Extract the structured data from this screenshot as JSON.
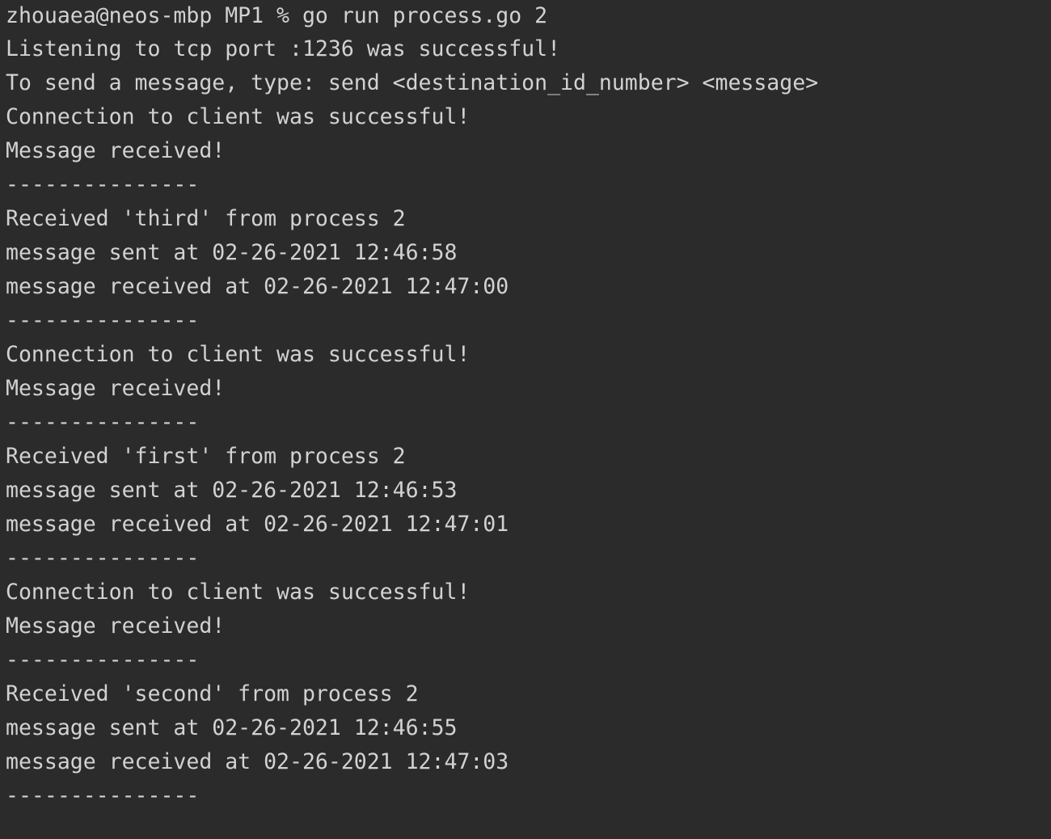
{
  "terminal": {
    "lines": [
      "zhouaea@neos-mbp MP1 % go run process.go 2",
      "Listening to tcp port :1236 was successful!",
      "To send a message, type: send <destination_id_number> <message>",
      "Connection to client was successful!",
      "Message received!",
      "---------------",
      "Received 'third' from process 2",
      "message sent at 02-26-2021 12:46:58",
      "message received at 02-26-2021 12:47:00",
      "---------------",
      "Connection to client was successful!",
      "Message received!",
      "---------------",
      "Received 'first' from process 2",
      "message sent at 02-26-2021 12:46:53",
      "message received at 02-26-2021 12:47:01",
      "---------------",
      "Connection to client was successful!",
      "Message received!",
      "---------------",
      "Received 'second' from process 2",
      "message sent at 02-26-2021 12:46:55",
      "message received at 02-26-2021 12:47:03",
      "---------------"
    ]
  },
  "colors": {
    "background": "#2b2b2b",
    "text": "#d2d2d2"
  }
}
